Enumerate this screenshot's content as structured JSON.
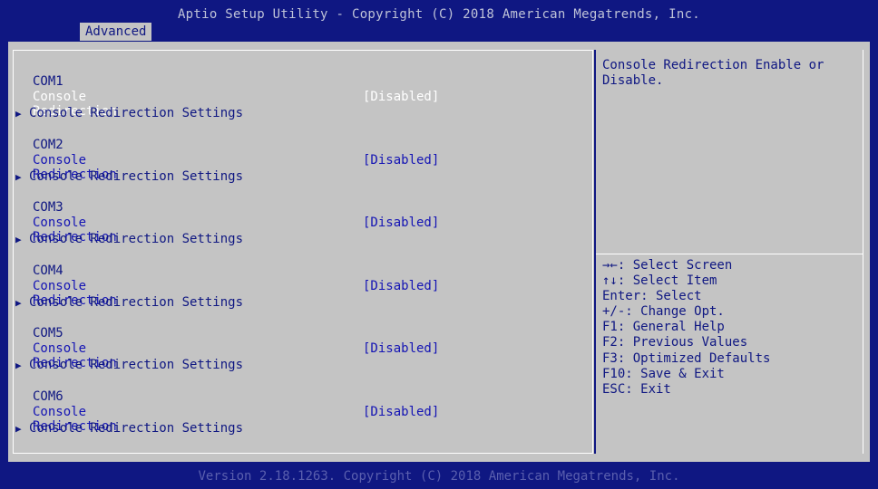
{
  "header": {
    "title": "Aptio Setup Utility - Copyright (C) 2018 American Megatrends, Inc.",
    "tab": "Advanced"
  },
  "ports": [
    {
      "name": "COM1",
      "redirection_label": "Console Redirection",
      "redirection_value": "[Disabled]",
      "settings_label": "Console Redirection Settings",
      "selected": true
    },
    {
      "name": "COM2",
      "redirection_label": "Console Redirection",
      "redirection_value": "[Disabled]",
      "settings_label": "Console Redirection Settings",
      "selected": false
    },
    {
      "name": "COM3",
      "redirection_label": "Console Redirection",
      "redirection_value": "[Disabled]",
      "settings_label": "Console Redirection Settings",
      "selected": false
    },
    {
      "name": "COM4",
      "redirection_label": "Console Redirection",
      "redirection_value": "[Disabled]",
      "settings_label": "Console Redirection Settings",
      "selected": false
    },
    {
      "name": "COM5",
      "redirection_label": "Console Redirection",
      "redirection_value": "[Disabled]",
      "settings_label": "Console Redirection Settings",
      "selected": false
    },
    {
      "name": "COM6",
      "redirection_label": "Console Redirection",
      "redirection_value": "[Disabled]",
      "settings_label": "Console Redirection Settings",
      "selected": false
    }
  ],
  "help": {
    "description": "Console Redirection Enable or Disable.",
    "keys": [
      "→←: Select Screen",
      "↑↓: Select Item",
      "Enter: Select",
      "+/-: Change Opt.",
      "F1: General Help",
      "F2: Previous Values",
      "F3: Optimized Defaults",
      "F10: Save & Exit",
      "ESC: Exit"
    ]
  },
  "footer": {
    "version": "Version 2.18.1263. Copyright (C) 2018 American Megatrends, Inc."
  },
  "colors": {
    "frame": "#0f1782",
    "panel": "#c4c4c4",
    "item": "#1414b4",
    "selected": "#ffffff"
  },
  "icons": {
    "submenu": "triangle-right-icon"
  }
}
